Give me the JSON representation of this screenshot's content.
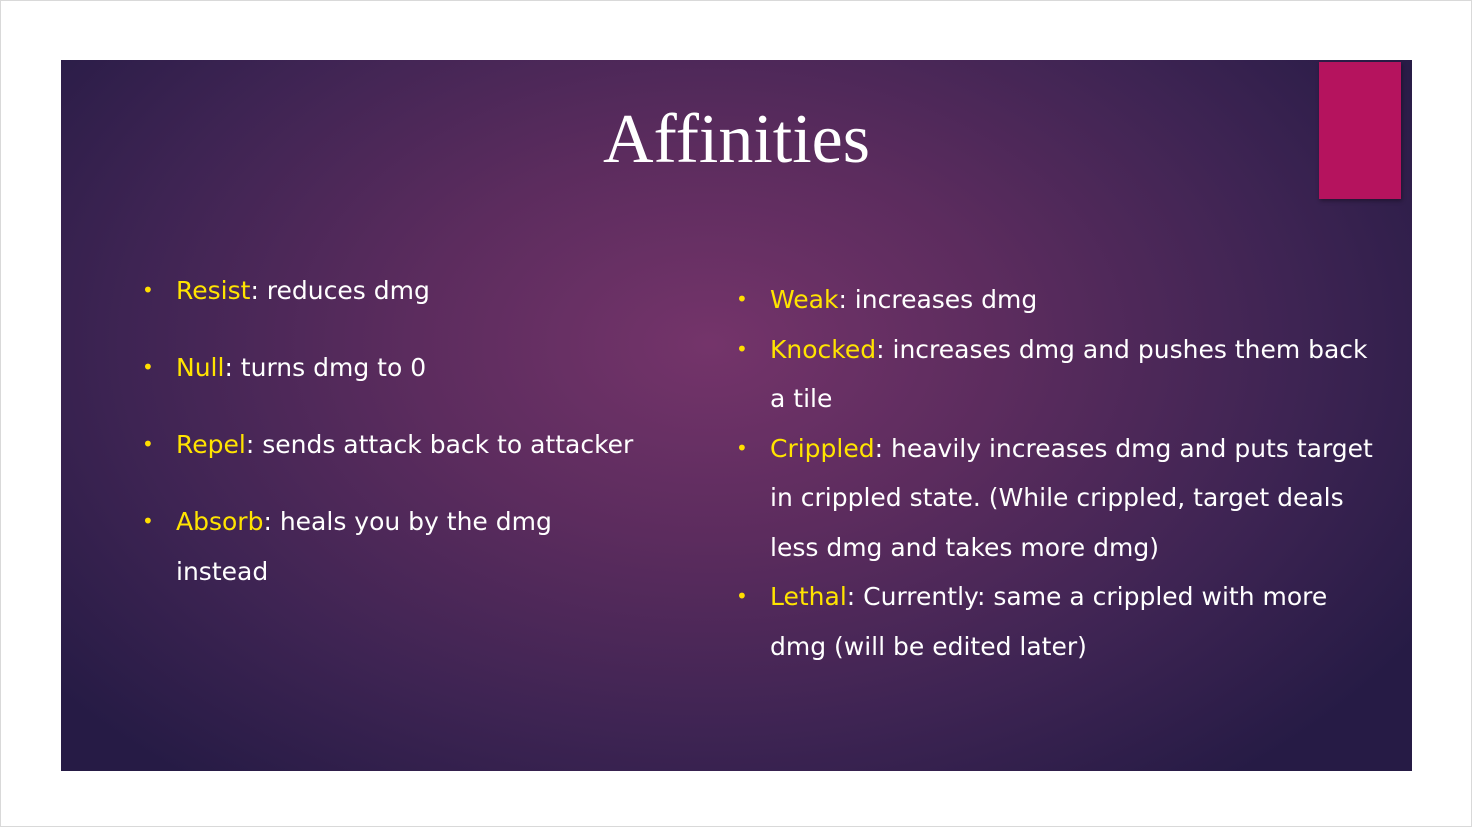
{
  "slide": {
    "title": "Affinities",
    "colors": {
      "accent_tab": "#b5135e",
      "term_highlight": "#ffe400",
      "bullet": "#ffde00",
      "text": "#ffffff"
    },
    "left_column": [
      {
        "term": "Resist",
        "text": ": reduces dmg"
      },
      {
        "term": "Null",
        "text": ": turns dmg to 0"
      },
      {
        "term": "Repel",
        "text": ": sends attack back to attacker"
      },
      {
        "term": "Absorb",
        "text": ": heals you by the dmg instead"
      }
    ],
    "right_column": [
      {
        "term": "Weak",
        "text": ": increases dmg"
      },
      {
        "term": "Knocked",
        "text": ": increases dmg and pushes them back a tile"
      },
      {
        "term": "Crippled",
        "text": ": heavily increases dmg and puts target in crippled state. (While crippled, target deals less dmg and takes more dmg)"
      },
      {
        "term": "Lethal",
        "text": ": Currently: same a crippled with more dmg (will be edited later)"
      }
    ],
    "bullet_glyph": "•"
  }
}
